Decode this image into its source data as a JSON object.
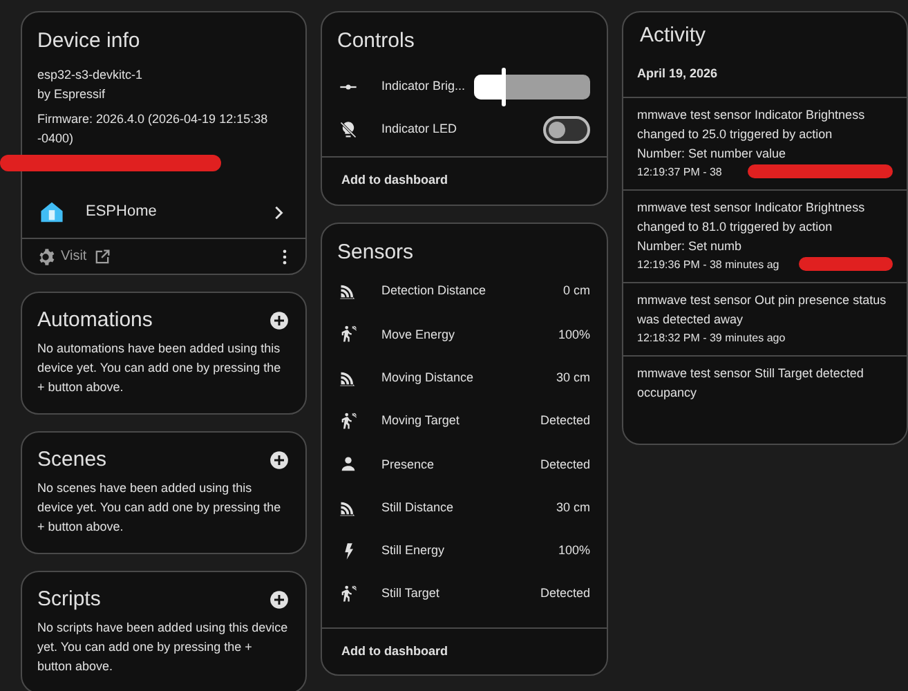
{
  "device_info": {
    "title": "Device info",
    "model": "esp32-s3-devkitc-1",
    "manufacturer": "by Espressif",
    "firmware": "Firmware: 2026.4.0 (2026-04-19 12:15:38 -0400)",
    "redacted": true,
    "integration": "ESPHome",
    "visit": "Visit"
  },
  "sections": [
    {
      "title": "Automations",
      "message": "No automations have been added using this device yet. You can add one by pressing the + button above."
    },
    {
      "title": "Scenes",
      "message": "No scenes have been added using this device yet. You can add one by pressing the + button above."
    },
    {
      "title": "Scripts",
      "message": "No scripts have been added using this device yet. You can add one by pressing the + button above."
    }
  ],
  "controls": {
    "title": "Controls",
    "items": [
      {
        "kind": "slider",
        "name": "Indicator Brig...",
        "level": 0.25
      },
      {
        "kind": "toggle",
        "name": "Indicator LED",
        "on": false
      }
    ],
    "footer": "Add to dashboard"
  },
  "sensors": {
    "title": "Sensors",
    "items": [
      {
        "kind": "distance",
        "name": "Detection Distance",
        "value": "0 cm"
      },
      {
        "kind": "motion",
        "name": "Move Energy",
        "value": "100%"
      },
      {
        "kind": "distance",
        "name": "Moving Distance",
        "value": "30 cm"
      },
      {
        "kind": "motion",
        "name": "Moving Target",
        "value": "Detected"
      },
      {
        "kind": "presence",
        "name": "Presence",
        "value": "Detected"
      },
      {
        "kind": "distance",
        "name": "Still Distance",
        "value": "30 cm"
      },
      {
        "kind": "energy",
        "name": "Still Energy",
        "value": "100%"
      },
      {
        "kind": "motion",
        "name": "Still Target",
        "value": "Detected"
      }
    ],
    "footer": "Add to dashboard"
  },
  "activity": {
    "title": "Activity",
    "date": "April 19, 2026",
    "entries": [
      {
        "message": "mmwave test sensor Indicator Brightness changed to 25.0 triggered by action",
        "detail": "Number: Set number value",
        "time": "12:19:37 PM - 38",
        "redacted": true
      },
      {
        "message": "mmwave test sensor Indicator Brightness changed to 81.0 triggered by action",
        "detail": "Number: Set numb",
        "time": "12:19:36 PM - 38 minutes ag",
        "redacted": true
      },
      {
        "message": "mmwave test sensor Out pin presence status",
        "detail": "was detected away",
        "time": "12:18:32 PM - 39 minutes ago",
        "redacted": false
      },
      {
        "message": "mmwave test sensor Still Target detected occupancy",
        "redacted": false
      }
    ]
  }
}
